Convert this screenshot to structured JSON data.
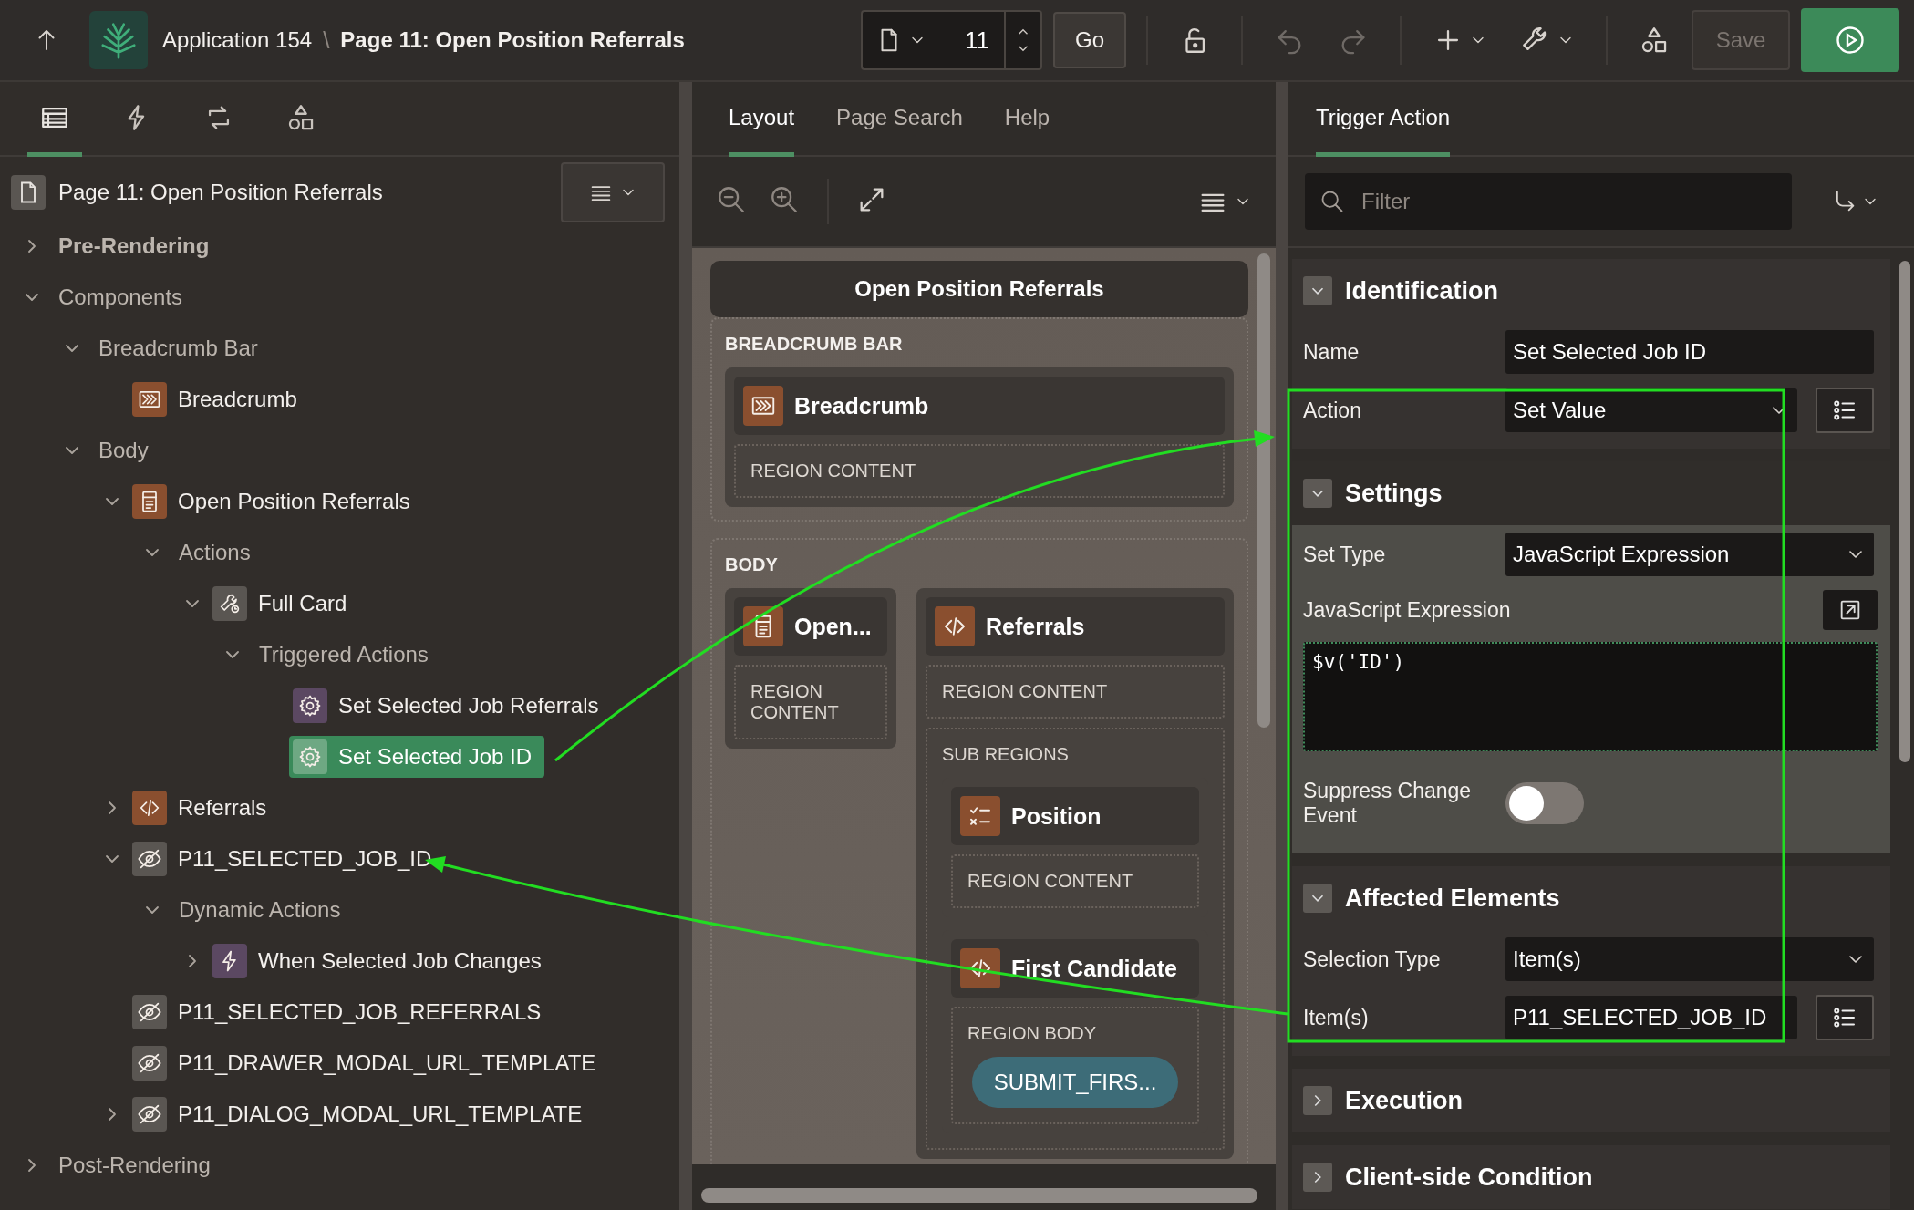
{
  "header": {
    "app_name": "Application 154",
    "separator": "\\",
    "page_title": "Page 11: Open Position Referrals",
    "page_number": "11",
    "go_label": "Go",
    "save": {
      "label": "Save",
      "disabled": true
    }
  },
  "left_panel": {
    "tabs": [
      {
        "kind": "rendering",
        "selected": true
      },
      {
        "kind": "dynamic-actions",
        "selected": false
      },
      {
        "kind": "processing",
        "selected": false
      },
      {
        "kind": "shared",
        "selected": false
      }
    ],
    "tree_root": "Page 11: Open Position Referrals",
    "tree": [
      {
        "label": "Pre-Rendering",
        "kind": "group",
        "bold": true,
        "expanded": false,
        "selected": false
      },
      {
        "label": "Components",
        "kind": "group",
        "bold": false,
        "expanded": true,
        "selected": false,
        "children": [
          {
            "label": "Breadcrumb Bar",
            "kind": "group",
            "expanded": true,
            "selected": false,
            "children": [
              {
                "label": "Breadcrumb",
                "kind": "breadcrumb",
                "selected": false
              }
            ]
          },
          {
            "label": "Body",
            "kind": "group",
            "expanded": true,
            "selected": false,
            "children": [
              {
                "label": "Open Position Referrals",
                "kind": "region",
                "expanded": true,
                "selected": false,
                "children": [
                  {
                    "label": "Actions",
                    "kind": "group",
                    "expanded": true,
                    "selected": false,
                    "children": [
                      {
                        "label": "Full Card",
                        "kind": "action",
                        "expanded": true,
                        "selected": false,
                        "children": [
                          {
                            "label": "Triggered Actions",
                            "kind": "group",
                            "expanded": true,
                            "selected": false,
                            "children": [
                              {
                                "label": "Set Selected Job Referrals",
                                "kind": "gear",
                                "selected": false
                              },
                              {
                                "label": "Set Selected Job ID",
                                "kind": "gear",
                                "selected": true
                              }
                            ]
                          }
                        ]
                      }
                    ]
                  }
                ]
              },
              {
                "label": "Referrals",
                "kind": "code",
                "expanded": false,
                "selected": false
              },
              {
                "label": "P11_SELECTED_JOB_ID",
                "kind": "hidden",
                "expanded": true,
                "selected": false,
                "children": [
                  {
                    "label": "Dynamic Actions",
                    "kind": "group",
                    "expanded": true,
                    "selected": false,
                    "children": [
                      {
                        "label": "When Selected Job Changes",
                        "kind": "bolt",
                        "expanded": false,
                        "selected": false
                      }
                    ]
                  }
                ]
              },
              {
                "label": "P11_SELECTED_JOB_REFERRALS",
                "kind": "hidden",
                "selected": false
              },
              {
                "label": "P11_DRAWER_MODAL_URL_TEMPLATE",
                "kind": "hidden",
                "selected": false
              },
              {
                "label": "P11_DIALOG_MODAL_URL_TEMPLATE",
                "kind": "hidden",
                "expanded": false,
                "selected": false
              }
            ]
          }
        ]
      },
      {
        "label": "Post-Rendering",
        "kind": "group",
        "bold": false,
        "expanded": false,
        "selected": false
      }
    ]
  },
  "middle_panel": {
    "tabs": [
      {
        "label": "Layout",
        "selected": true
      },
      {
        "label": "Page Search",
        "selected": false
      },
      {
        "label": "Help",
        "selected": false
      }
    ],
    "layout": {
      "page_title": "Open Position Referrals",
      "positions": [
        {
          "label": "BREADCRUMB BAR",
          "regions": [
            {
              "title": "Breadcrumb",
              "kind": "breadcrumb",
              "slots": [
                {
                  "label": "REGION CONTENT"
                }
              ]
            }
          ]
        },
        {
          "label": "BODY",
          "regions": [
            {
              "title": "Open...",
              "kind": "region",
              "slots": [
                {
                  "label": "REGION CONTENT"
                }
              ]
            },
            {
              "title": "Referrals",
              "kind": "code",
              "slots": [
                {
                  "label": "REGION CONTENT"
                },
                {
                  "label": "SUB REGIONS",
                  "regions": [
                    {
                      "title": "Position",
                      "kind": "checklist",
                      "slots": [
                        {
                          "label": "REGION CONTENT"
                        }
                      ]
                    },
                    {
                      "title": "First Candidate",
                      "kind": "code",
                      "slots": [
                        {
                          "label": "REGION BODY",
                          "buttons": [
                            "SUBMIT_FIRS..."
                          ]
                        }
                      ]
                    }
                  ]
                }
              ]
            }
          ]
        }
      ]
    }
  },
  "property_panel": {
    "tab": {
      "label": "Trigger Action",
      "selected": true
    },
    "filter_placeholder": "Filter",
    "sections": [
      {
        "title": "Identification",
        "expanded": true,
        "highlighted": false,
        "rows": [
          {
            "kind": "text",
            "label": "Name",
            "value": "Set Selected Job ID",
            "picker": false
          },
          {
            "kind": "select",
            "label": "Action",
            "value": "Set Value",
            "picker": true
          }
        ]
      },
      {
        "title": "Settings",
        "expanded": true,
        "highlighted": true,
        "rows": [
          {
            "kind": "select",
            "label": "Set Type",
            "value": "JavaScript Expression",
            "picker": false
          },
          {
            "kind": "code",
            "label": "JavaScript Expression",
            "value": "$v('ID')"
          },
          {
            "kind": "switch",
            "label": "Suppress Change Event",
            "on": false
          }
        ]
      },
      {
        "title": "Affected Elements",
        "expanded": true,
        "highlighted": false,
        "rows": [
          {
            "kind": "select",
            "label": "Selection Type",
            "value": "Item(s)",
            "picker": false
          },
          {
            "kind": "text",
            "label": "Item(s)",
            "value": "P11_SELECTED_JOB_ID",
            "picker": true
          }
        ]
      },
      {
        "title": "Execution",
        "expanded": false
      },
      {
        "title": "Client-side Condition",
        "expanded": false
      }
    ]
  }
}
